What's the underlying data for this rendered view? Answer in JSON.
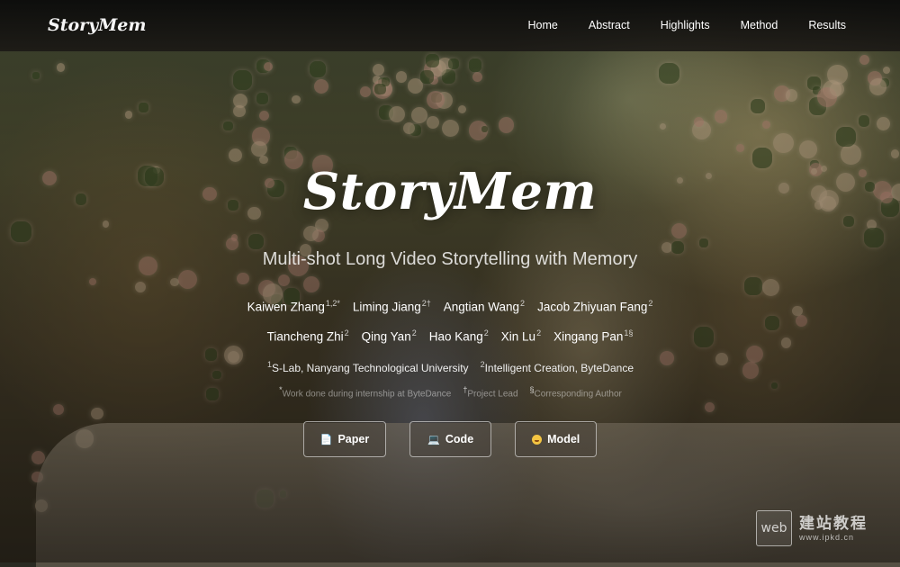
{
  "nav": {
    "brand": "StoryMem",
    "items": [
      "Home",
      "Abstract",
      "Highlights",
      "Method",
      "Results"
    ]
  },
  "hero": {
    "title": "StoryMem",
    "subtitle": "Multi-shot Long Video Storytelling with Memory",
    "authors_row1": [
      {
        "name": "Kaiwen Zhang",
        "sup": "1,2*"
      },
      {
        "name": "Liming Jiang",
        "sup": "2†"
      },
      {
        "name": "Angtian Wang",
        "sup": "2"
      },
      {
        "name": "Jacob Zhiyuan Fang",
        "sup": "2"
      }
    ],
    "authors_row2": [
      {
        "name": "Tiancheng Zhi",
        "sup": "2"
      },
      {
        "name": "Qing Yan",
        "sup": "2"
      },
      {
        "name": "Hao Kang",
        "sup": "2"
      },
      {
        "name": "Xin Lu",
        "sup": "2"
      },
      {
        "name": "Xingang Pan",
        "sup": "1§"
      }
    ],
    "affiliations": [
      {
        "sup": "1",
        "text": "S-Lab, Nanyang Technological University"
      },
      {
        "sup": "2",
        "text": "Intelligent Creation, ByteDance"
      }
    ],
    "notes": [
      {
        "sup": "*",
        "text": "Work done during internship at ByteDance"
      },
      {
        "sup": "†",
        "text": "Project Lead"
      },
      {
        "sup": "§",
        "text": "Corresponding Author"
      }
    ],
    "buttons": [
      {
        "icon": "document-icon",
        "label": "Paper"
      },
      {
        "icon": "laptop-icon",
        "label": "Code"
      },
      {
        "icon": "hugging-face-icon",
        "label": "Model"
      }
    ]
  },
  "watermark": {
    "box": "web",
    "cn": "建站教程",
    "url": "www.ipkd.cn"
  }
}
